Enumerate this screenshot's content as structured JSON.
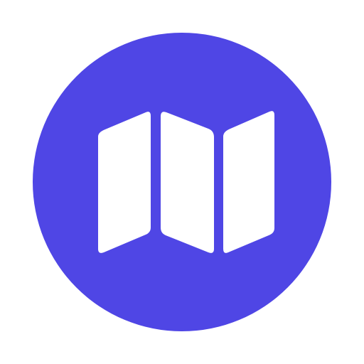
{
  "app_icon": {
    "icon_name": "folded-map-icon",
    "background_color": "#4F46E5",
    "glyph_color": "#FFFFFF",
    "page_background": "#FFFFFF"
  }
}
